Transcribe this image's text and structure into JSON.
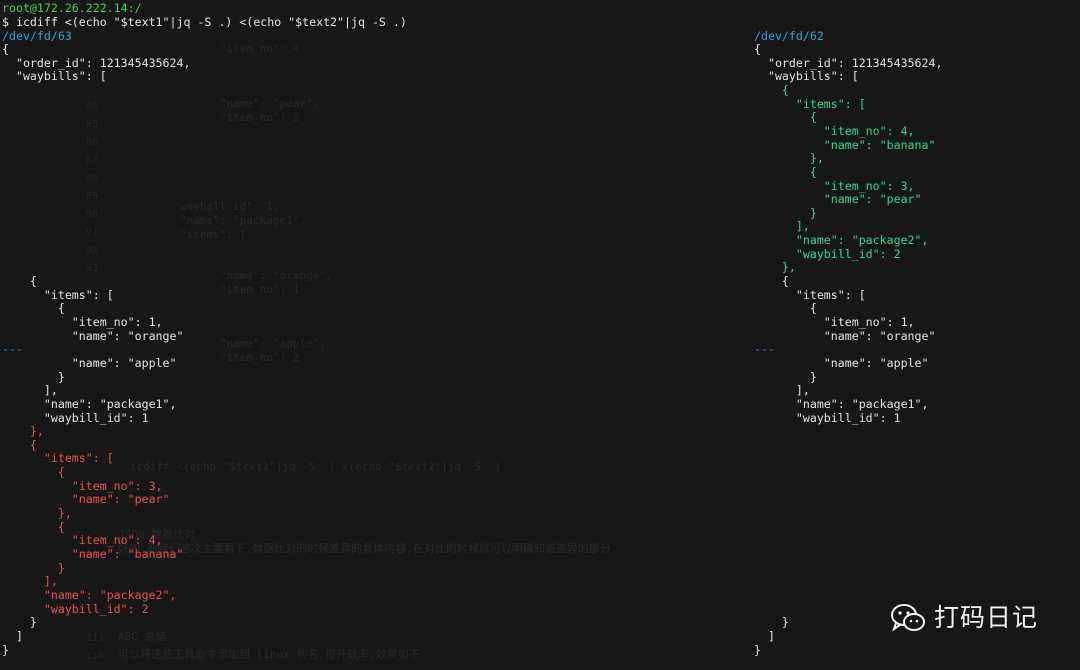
{
  "terminal": {
    "prompt_user": "root@172.26.222.14:/",
    "command": "$ icdiff <(echo \"$text1\"|jq -S .) <(echo \"$text2\"|jq -S .)"
  },
  "left_pane": {
    "path": "/dev/fd/63",
    "lines": [
      {
        "row": 3,
        "text": "{",
        "cls": "normal"
      },
      {
        "row": 4,
        "text": "  \"order_id\": 121345435624,",
        "cls": "normal"
      },
      {
        "row": 5,
        "text": "  \"waybills\": [",
        "cls": "normal"
      },
      {
        "row": 20,
        "text": "    {",
        "cls": "normal"
      },
      {
        "row": 21,
        "text": "      \"items\": [",
        "cls": "normal"
      },
      {
        "row": 22,
        "text": "        {",
        "cls": "normal"
      },
      {
        "row": 23,
        "text": "          \"item_no\": 1,",
        "cls": "normal"
      },
      {
        "row": 24,
        "text": "          \"name\": \"orange\"",
        "cls": "normal"
      },
      {
        "row": 25,
        "text": "---",
        "cls": "sep"
      },
      {
        "row": 26,
        "text": "          \"name\": \"apple\"",
        "cls": "normal"
      },
      {
        "row": 27,
        "text": "        }",
        "cls": "normal"
      },
      {
        "row": 28,
        "text": "      ],",
        "cls": "normal"
      },
      {
        "row": 29,
        "text": "      \"name\": \"package1\",",
        "cls": "normal"
      },
      {
        "row": 30,
        "text": "      \"waybill_id\": 1",
        "cls": "normal"
      },
      {
        "row": 31,
        "text": "    },",
        "cls": "red"
      },
      {
        "row": 32,
        "text": "    {",
        "cls": "red"
      },
      {
        "row": 33,
        "text": "      \"items\": [",
        "cls": "red"
      },
      {
        "row": 34,
        "text": "        {",
        "cls": "red"
      },
      {
        "row": 35,
        "text": "          \"item_no\": 3,",
        "cls": "red"
      },
      {
        "row": 36,
        "text": "          \"name\": \"pear\"",
        "cls": "red"
      },
      {
        "row": 37,
        "text": "        },",
        "cls": "red"
      },
      {
        "row": 38,
        "text": "        {",
        "cls": "red"
      },
      {
        "row": 39,
        "text": "          \"item_no\": 4,",
        "cls": "red"
      },
      {
        "row": 40,
        "text": "          \"name\": \"banana\"",
        "cls": "red"
      },
      {
        "row": 41,
        "text": "        }",
        "cls": "red"
      },
      {
        "row": 42,
        "text": "      ],",
        "cls": "red"
      },
      {
        "row": 43,
        "text": "      \"name\": \"package2\",",
        "cls": "red"
      },
      {
        "row": 44,
        "text": "      \"waybill_id\": 2",
        "cls": "red"
      },
      {
        "row": 45,
        "text": "    }",
        "cls": "normal"
      },
      {
        "row": 46,
        "text": "  ]",
        "cls": "normal"
      },
      {
        "row": 47,
        "text": "}",
        "cls": "normal"
      }
    ]
  },
  "right_pane": {
    "path": "/dev/fd/62",
    "lines": [
      {
        "row": 3,
        "text": "{",
        "cls": "normal"
      },
      {
        "row": 4,
        "text": "  \"order_id\": 121345435624,",
        "cls": "normal"
      },
      {
        "row": 5,
        "text": "  \"waybills\": [",
        "cls": "normal"
      },
      {
        "row": 6,
        "text": "    {",
        "cls": "green"
      },
      {
        "row": 7,
        "text": "      \"items\": [",
        "cls": "green"
      },
      {
        "row": 8,
        "text": "        {",
        "cls": "green"
      },
      {
        "row": 9,
        "text": "          \"item_no\": 4,",
        "cls": "green"
      },
      {
        "row": 10,
        "text": "          \"name\": \"banana\"",
        "cls": "green"
      },
      {
        "row": 11,
        "text": "        },",
        "cls": "green"
      },
      {
        "row": 12,
        "text": "        {",
        "cls": "green"
      },
      {
        "row": 13,
        "text": "          \"item_no\": 3,",
        "cls": "green"
      },
      {
        "row": 14,
        "text": "          \"name\": \"pear\"",
        "cls": "green"
      },
      {
        "row": 15,
        "text": "        }",
        "cls": "green"
      },
      {
        "row": 16,
        "text": "      ],",
        "cls": "green"
      },
      {
        "row": 17,
        "text": "      \"name\": \"package2\",",
        "cls": "green"
      },
      {
        "row": 18,
        "text": "      \"waybill_id\": 2",
        "cls": "green"
      },
      {
        "row": 19,
        "text": "    },",
        "cls": "green"
      },
      {
        "row": 20,
        "text": "    {",
        "cls": "normal"
      },
      {
        "row": 21,
        "text": "      \"items\": [",
        "cls": "normal"
      },
      {
        "row": 22,
        "text": "        {",
        "cls": "normal"
      },
      {
        "row": 23,
        "text": "          \"item_no\": 1,",
        "cls": "normal"
      },
      {
        "row": 24,
        "text": "          \"name\": \"orange\"",
        "cls": "normal"
      },
      {
        "row": 25,
        "text": "---",
        "cls": "sep"
      },
      {
        "row": 26,
        "text": "          \"name\": \"apple\"",
        "cls": "normal"
      },
      {
        "row": 27,
        "text": "        }",
        "cls": "normal"
      },
      {
        "row": 28,
        "text": "      ],",
        "cls": "normal"
      },
      {
        "row": 29,
        "text": "      \"name\": \"package1\",",
        "cls": "normal"
      },
      {
        "row": 30,
        "text": "      \"waybill_id\": 1",
        "cls": "normal"
      },
      {
        "row": 45,
        "text": "    }",
        "cls": "normal"
      },
      {
        "row": 46,
        "text": "  ]",
        "cls": "normal"
      },
      {
        "row": 47,
        "text": "}",
        "cls": "normal"
      }
    ]
  },
  "watermark": {
    "icon": "wechat-icon",
    "text": "打码日记"
  }
}
